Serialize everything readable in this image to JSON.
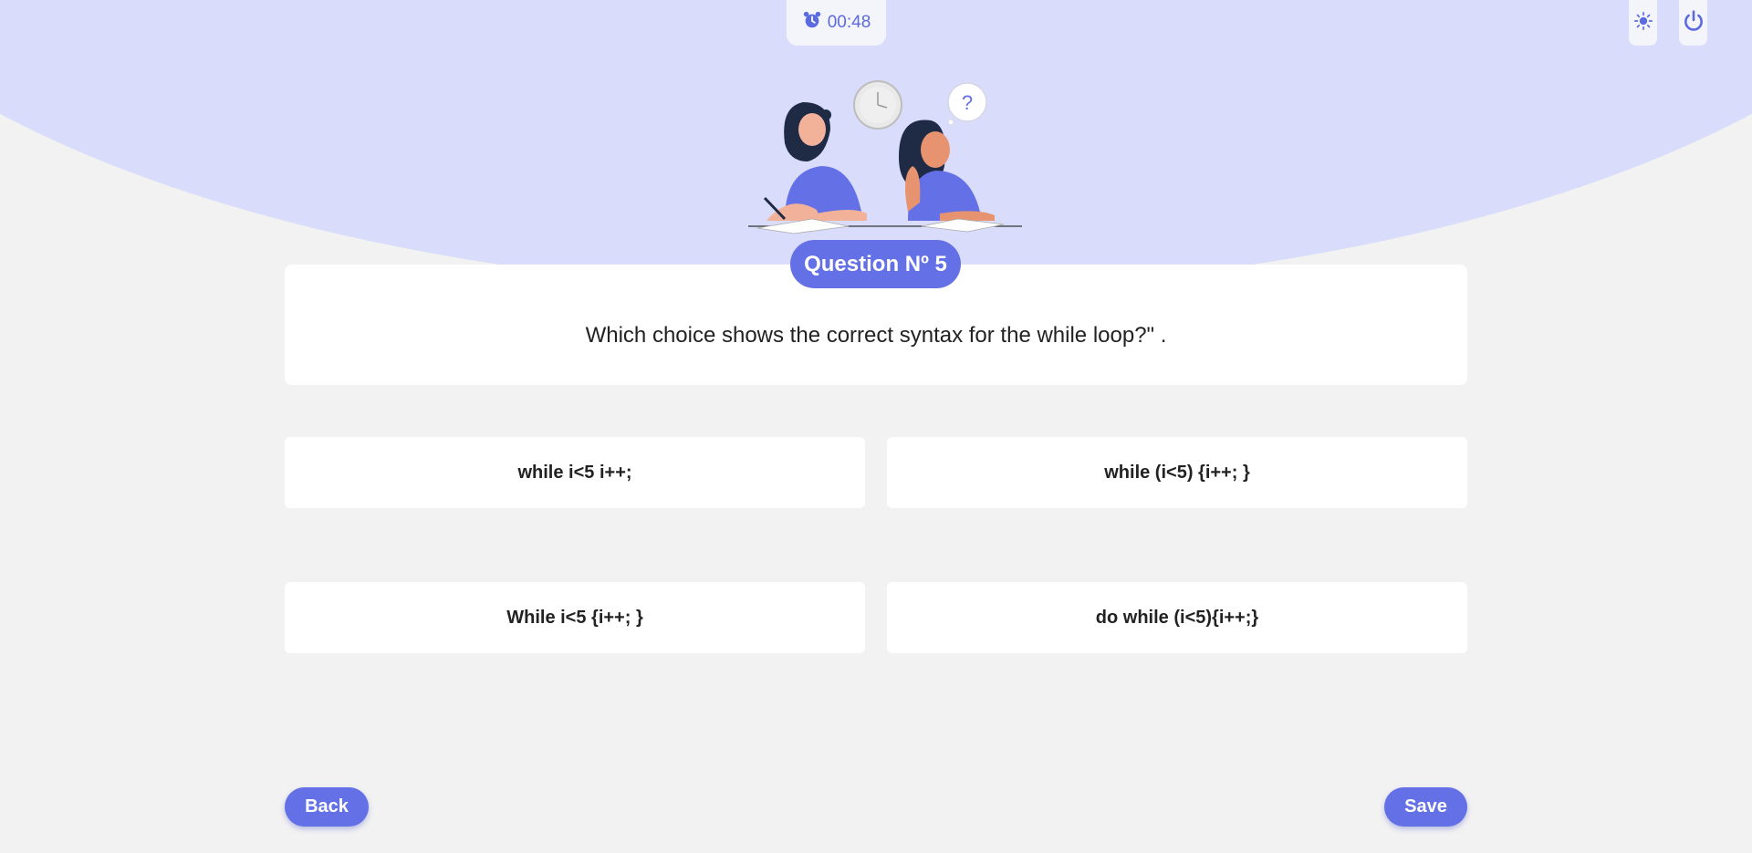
{
  "timer": {
    "value": "00:48",
    "icon": "alarm-clock-icon"
  },
  "top_controls": {
    "theme_icon": "sun-icon",
    "power_icon": "power-icon"
  },
  "question": {
    "badge": "Question Nº 5",
    "text": "Which choice shows the correct syntax for the while loop?\" ."
  },
  "choices": [
    {
      "label": "while i<5 i++;"
    },
    {
      "label": "while (i<5) {i++; }"
    },
    {
      "label": "While i<5 {i++; }"
    },
    {
      "label": "do while (i<5){i++;}"
    }
  ],
  "illustration": {
    "bubble_text": "?"
  },
  "navigation": {
    "back_label": "Back",
    "save_label": "Save"
  },
  "colors": {
    "accent": "#6470e6",
    "hero_bg": "#d9dcfa",
    "page_bg": "#f2f2f2"
  }
}
